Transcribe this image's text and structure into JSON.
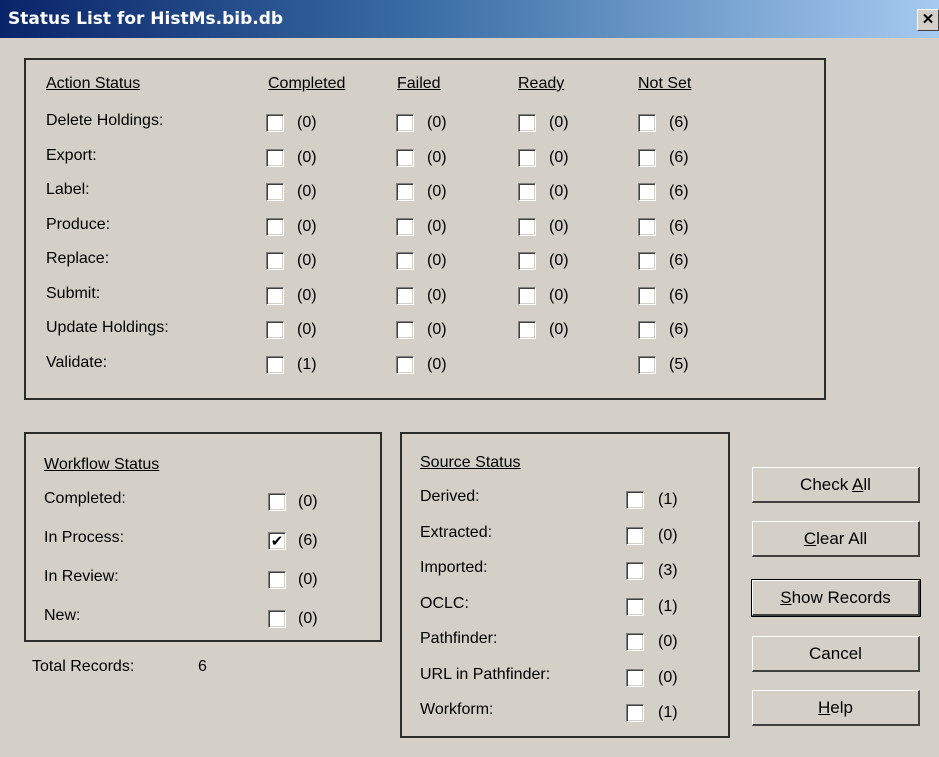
{
  "window": {
    "title": "Status List for HistMs.bib.db",
    "close_glyph": "✕"
  },
  "action_status": {
    "header": "Action Status",
    "columns": [
      "Completed",
      "Failed",
      "Ready",
      "Not Set"
    ],
    "rows": [
      {
        "label": "Delete Holdings:",
        "cells": [
          "(0)",
          "(0)",
          "(0)",
          "(6)"
        ]
      },
      {
        "label": "Export:",
        "cells": [
          "(0)",
          "(0)",
          "(0)",
          "(6)"
        ]
      },
      {
        "label": "Label:",
        "cells": [
          "(0)",
          "(0)",
          "(0)",
          "(6)"
        ]
      },
      {
        "label": "Produce:",
        "cells": [
          "(0)",
          "(0)",
          "(0)",
          "(6)"
        ]
      },
      {
        "label": "Replace:",
        "cells": [
          "(0)",
          "(0)",
          "(0)",
          "(6)"
        ]
      },
      {
        "label": "Submit:",
        "cells": [
          "(0)",
          "(0)",
          "(0)",
          "(6)"
        ]
      },
      {
        "label": "Update Holdings:",
        "cells": [
          "(0)",
          "(0)",
          "(0)",
          "(6)"
        ]
      },
      {
        "label": "Validate:",
        "cells": [
          "(1)",
          "(0)",
          null,
          "(5)"
        ]
      }
    ]
  },
  "workflow_status": {
    "header": "Workflow Status",
    "rows": [
      {
        "label": "Completed:",
        "count": "(0)",
        "checked": false
      },
      {
        "label": "In Process:",
        "count": "(6)",
        "checked": true
      },
      {
        "label": "In Review:",
        "count": "(0)",
        "checked": false
      },
      {
        "label": "New:",
        "count": "(0)",
        "checked": false
      }
    ]
  },
  "source_status": {
    "header": "Source Status",
    "rows": [
      {
        "label": "Derived:",
        "count": "(1)"
      },
      {
        "label": "Extracted:",
        "count": "(0)"
      },
      {
        "label": "Imported:",
        "count": "(3)"
      },
      {
        "label": "OCLC:",
        "count": "(1)"
      },
      {
        "label": "Pathfinder:",
        "count": "(0)"
      },
      {
        "label": "URL in Pathfinder:",
        "count": "(0)"
      },
      {
        "label": "Workform:",
        "count": "(1)"
      }
    ]
  },
  "total": {
    "label": "Total Records:",
    "value": "6"
  },
  "buttons": {
    "check_all": {
      "pre": "Check ",
      "hotkey": "A",
      "post": "ll"
    },
    "clear_all": {
      "pre": "",
      "hotkey": "C",
      "post": "lear All"
    },
    "show_records": {
      "pre": "",
      "hotkey": "S",
      "post": "how Records"
    },
    "cancel": {
      "label": "Cancel"
    },
    "help": {
      "pre": "",
      "hotkey": "H",
      "post": "elp"
    }
  },
  "checkmark_glyph": "✔"
}
